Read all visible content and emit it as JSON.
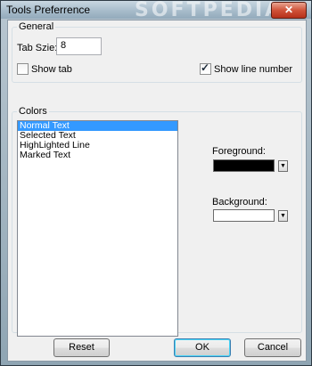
{
  "window": {
    "title": "Tools Preferrence",
    "watermark": "SOFTPEDIA",
    "close_glyph": "✕"
  },
  "general": {
    "legend": "General",
    "tab_size_label": "Tab Szie:",
    "tab_size_value": "8",
    "show_tab_label": "Show tab",
    "show_tab_checked": false,
    "show_line_number_label": "Show line number",
    "show_line_number_checked": true
  },
  "colors": {
    "legend": "Colors",
    "items": [
      "Normal Text",
      "Selected Text",
      "HighLighted Line",
      "Marked Text"
    ],
    "selected_index": 0,
    "foreground_label": "Foreground:",
    "foreground_color": "#000000",
    "background_label": "Background:",
    "background_color": "#ffffff"
  },
  "buttons": {
    "reset": "Reset",
    "ok": "OK",
    "cancel": "Cancel"
  },
  "icons": {
    "check": "✓",
    "dropdown_arrow": "▼"
  }
}
